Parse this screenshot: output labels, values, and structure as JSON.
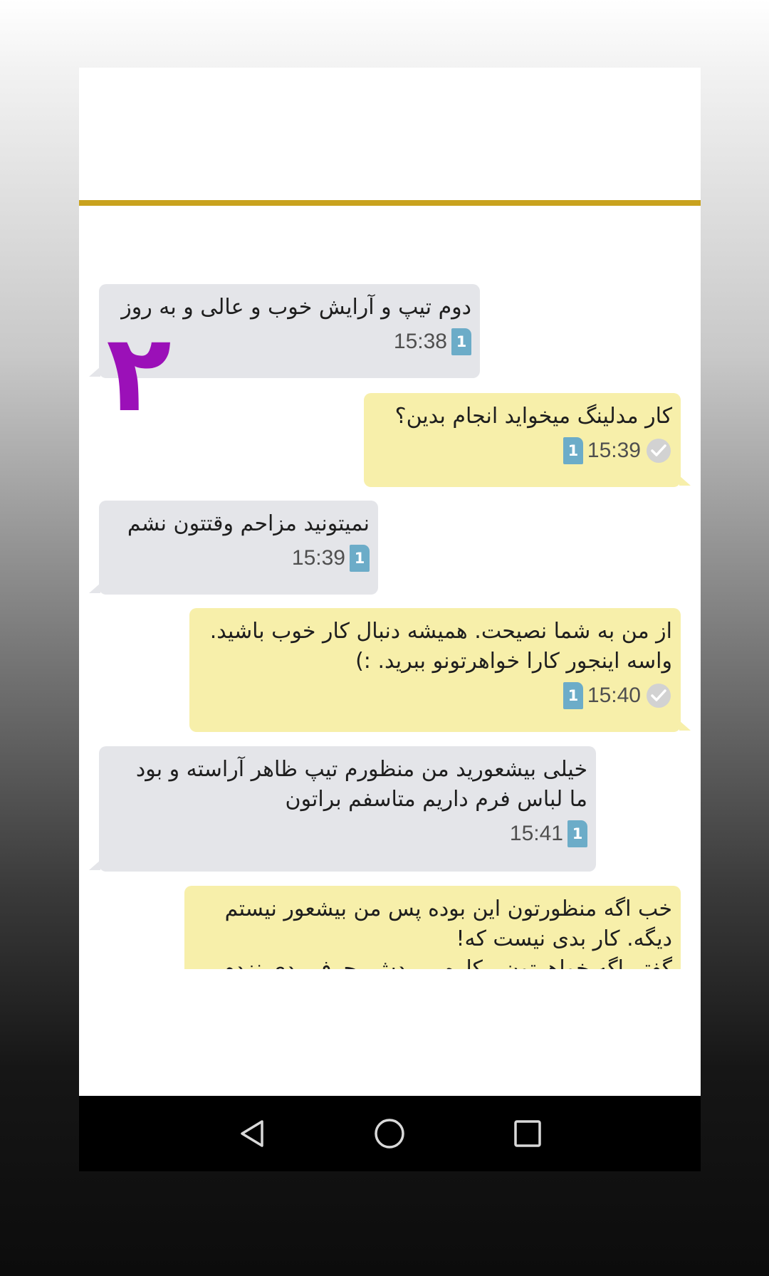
{
  "messages": [
    {
      "direction": "in",
      "text": "دوم تیپ و آرایش خوب و عالی و به روز",
      "time": "15:38",
      "sim": "1"
    },
    {
      "direction": "out",
      "text": "کار مدلینگ میخواید انجام بدین؟",
      "time": "15:39",
      "sim": "1"
    },
    {
      "direction": "in",
      "text": "نمیتونید مزاحم وقتتون نشم",
      "time": "15:39",
      "sim": "1"
    },
    {
      "direction": "out",
      "text": "از من به شما نصیحت. همیشه دنبال کار خوب باشید.\nواسه اینجور کارا خواهرتونو ببرید. :)",
      "time": "15:40",
      "sim": "1"
    },
    {
      "direction": "in",
      "text": "خیلی بیشعورید  من منظورم تیپ ظاهر آراسته و بود\nما لباس فرم داریم متاسفم براتون",
      "time": "15:41",
      "sim": "1"
    },
    {
      "direction": "out",
      "text": "خب اگه منظورتون این بوده پس من بیشعور نیستم\nدیگه. کار بدی نیست که!\nگفتم اگه خواهرتون بیکاره ببریدش. حرف بدی نزدم.\nپیش برادرشم هست. جاش امنه"
    }
  ],
  "overlay_number": "۲",
  "icons": {
    "read": "double-check-icon",
    "sim": "sim-card-icon",
    "emoji": "smiley-icon"
  },
  "colors": {
    "incoming_bubble": "#e4e5e9",
    "outgoing_bubble": "#f7efaa",
    "gold_line": "#c9a21e",
    "overlay_number": "#9b10b8",
    "sim_icon": "#6cacc8"
  },
  "navbar": {
    "back": "back-icon",
    "home": "home-icon",
    "recents": "recents-icon"
  }
}
